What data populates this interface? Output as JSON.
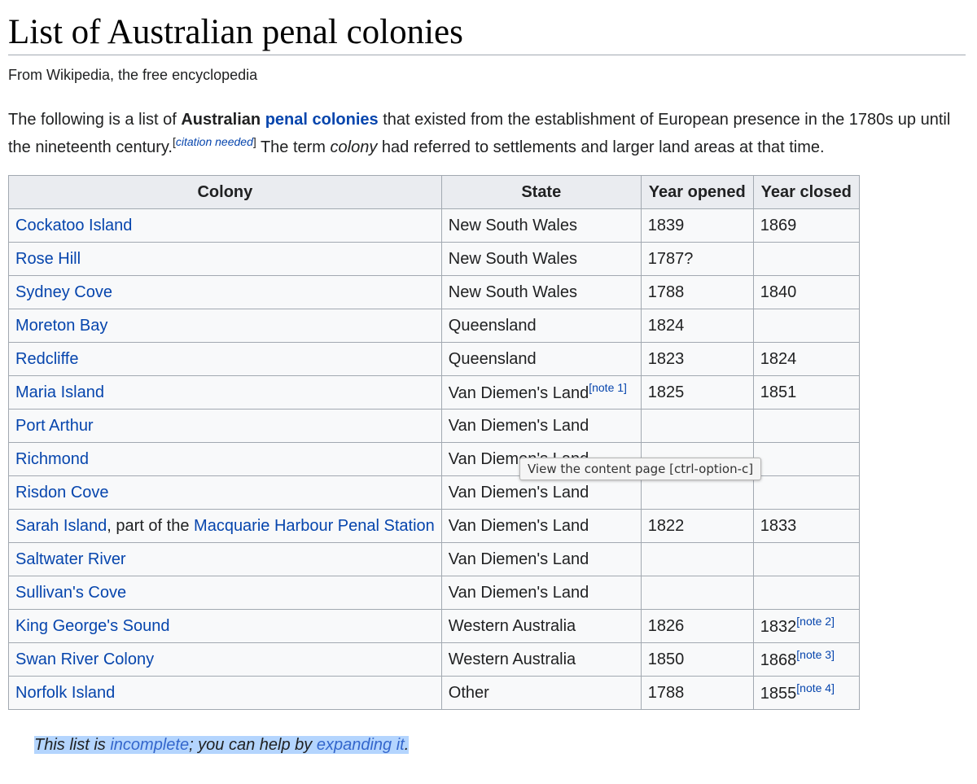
{
  "page": {
    "title": "List of Australian penal colonies",
    "tagline": "From Wikipedia, the free encyclopedia"
  },
  "intro": {
    "part1": "The following is a list of ",
    "bold1": "Australian",
    "space": " ",
    "link1": "penal colonies",
    "part2": " that existed from the establishment of European presence in the 1780s up until the nineteenth century.",
    "cite_open": "[",
    "cite_text": "citation needed",
    "cite_close": "]",
    "part3": " The term ",
    "italic": "colony",
    "part4": " had referred to settlements and larger land areas at that time."
  },
  "table": {
    "headers": [
      "Colony",
      "State",
      "Year opened",
      "Year closed"
    ],
    "rows": [
      {
        "colony": "Cockatoo Island",
        "state": "New South Wales",
        "opened": "1839",
        "closed": "1869"
      },
      {
        "colony": "Rose Hill",
        "state": "New South Wales",
        "opened": "1787?",
        "closed": ""
      },
      {
        "colony": "Sydney Cove",
        "state": "New South Wales",
        "opened": "1788",
        "closed": "1840"
      },
      {
        "colony": "Moreton Bay",
        "state": "Queensland",
        "opened": "1824",
        "closed": ""
      },
      {
        "colony": "Redcliffe",
        "state": "Queensland",
        "opened": "1823",
        "closed": "1824"
      },
      {
        "colony": "Maria Island",
        "state": "Van Diemen's Land",
        "state_note": "[note 1]",
        "opened": "1825",
        "closed": "1851"
      },
      {
        "colony": "Port Arthur",
        "state": "Van Diemen's Land",
        "opened": "",
        "closed": ""
      },
      {
        "colony": "Richmond",
        "state": "Van Diemen's Land",
        "opened": "",
        "closed": ""
      },
      {
        "colony": "Risdon Cove",
        "state": "Van Diemen's Land",
        "opened": "",
        "closed": ""
      },
      {
        "colony": "Sarah Island",
        "colony_mid": ", part of the ",
        "colony_link2": "Macquarie Harbour Penal Station",
        "state": "Van Diemen's Land",
        "opened": "1822",
        "closed": "1833"
      },
      {
        "colony": "Saltwater River",
        "state": "Van Diemen's Land",
        "opened": "",
        "closed": ""
      },
      {
        "colony": "Sullivan's Cove",
        "state": "Van Diemen's Land",
        "opened": "",
        "closed": ""
      },
      {
        "colony": "King George's Sound",
        "state": "Western Australia",
        "opened": "1826",
        "closed": "1832",
        "closed_note": "[note 2]"
      },
      {
        "colony": "Swan River Colony",
        "state": "Western Australia",
        "opened": "1850",
        "closed": "1868",
        "closed_note": "[note 3]"
      },
      {
        "colony": "Norfolk Island",
        "state": "Other",
        "opened": "1788",
        "closed": "1855",
        "closed_note": "[note 4]"
      }
    ]
  },
  "tooltip": "View the content page [ctrl-option-c]",
  "footnote": {
    "part1": "This list is ",
    "link1": "incomplete",
    "part2": "; you can help by ",
    "link2": "expanding it",
    "part3": "."
  }
}
